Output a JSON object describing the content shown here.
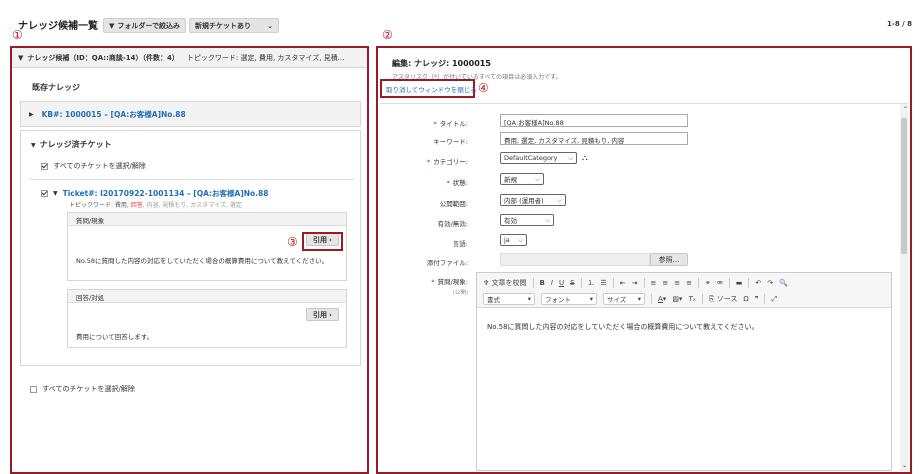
{
  "header": {
    "title": "ナレッジ候補一覧",
    "filter_label": "フォルダーで絞込み",
    "new_ticket_label": "新規チケットあり",
    "counter": "1-8 / 8"
  },
  "markers": {
    "m1": "①",
    "m2": "②",
    "m3": "③",
    "m4": "④"
  },
  "left": {
    "header_title": "ナレッジ候補（ID：QA::商談-14）（件数：4）",
    "header_keywords": "トピックワード: 選定, 費用, カスタマイズ, 見積...",
    "existing_label": "既存ナレッジ",
    "kb_link": "KB#: 1000015 – [QA:お客様A]No.88",
    "answered_label": "ナレッジ済チケット",
    "select_all": "すべてのチケットを選択/解除",
    "ticket_link": "Ticket#: I20170922-1001134 – [QA:お客様A]No.88",
    "topic_prefix": "トピックワード: 費用,",
    "topic_highlight": "回答",
    "topic_rest": ", 内容, 見積もり, カスタマイズ, 選定",
    "question_label": "質問/現象",
    "quote_label": "引用",
    "question_text": "No.58に質問した内容の対応をしていただく場合の概算費用について教えてください。",
    "answer_label": "回答/対処",
    "answer_text": "費用について回答します。",
    "select_all_bottom": "すべてのチケットを選択/解除"
  },
  "right": {
    "title": "編集: ナレッジ: 1000015",
    "note": "アスタリスク（*）が付いているすべての項目は必須入力です。",
    "cancel_link": "取り消してウィンドウを閉じる",
    "fields": {
      "title_label": "タイトル:",
      "title_value": "[QA:お客様A]No.88",
      "keyword_label": "キーワード:",
      "keyword_value": "費用, 選定, カスタマイズ, 見積もり, 内容",
      "category_label": "カテゴリー:",
      "category_value": "DefaultCategory",
      "state_label": "状態:",
      "state_value": "新規",
      "scope_label": "公開範囲:",
      "scope_value": "内部 (運用者)",
      "valid_label": "有効/無効:",
      "valid_value": "有効",
      "lang_label": "言語:",
      "lang_value": "ja",
      "attach_label": "添付ファイル:",
      "browse_label": "参照...",
      "question_label": "質問/現象:",
      "question_sub": "(公開)"
    },
    "editor": {
      "proof_label": "文章を校閲",
      "format_label": "書式",
      "font_label": "フォント",
      "size_label": "サイズ",
      "source_label": "ソース",
      "content": "No.58に質問した内容の対応をしていただく場合の概算費用について教えてください。"
    }
  },
  "colors": {
    "accent_red": "#9b1a23",
    "link_blue": "#1f6fb8",
    "required": "#d1101b"
  }
}
